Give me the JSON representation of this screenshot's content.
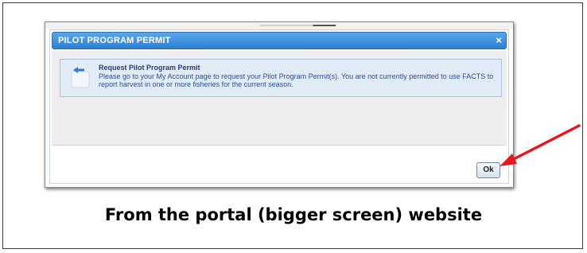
{
  "dialog": {
    "title": "PILOT PROGRAM PERMIT",
    "close_glyph": "×",
    "info_title": "Request Pilot Program Permit",
    "info_message": "Please go to your My Account page to request your Pilot Program Permit(s). You are not currently permitted to use FACTS to report harvest in one or more fisheries for the current season.",
    "ok_label": "Ok"
  },
  "caption": "From the portal (bigger screen) website",
  "icons": {
    "info": "info-icon",
    "close": "close-icon",
    "annotation": "arrow-icon"
  },
  "colors": {
    "titlebar": "#3a8de0",
    "info_background": "#e2ecf7",
    "arrow": "#e8161e"
  }
}
